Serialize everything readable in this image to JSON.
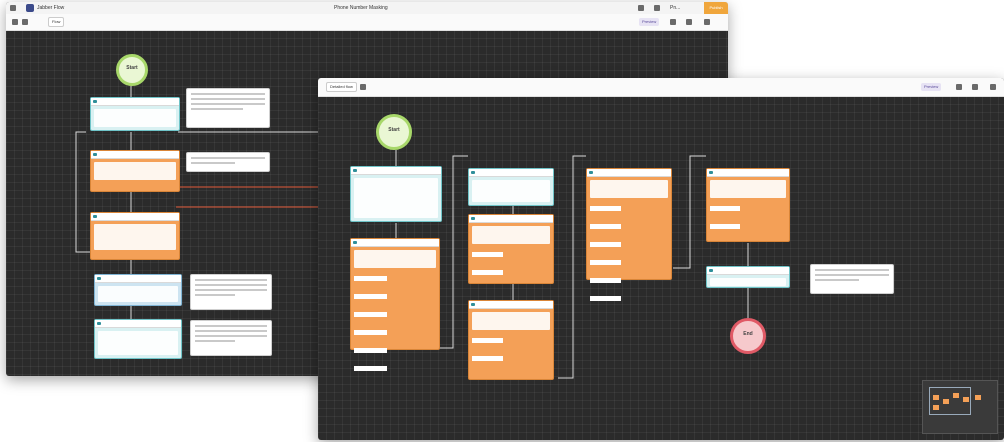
{
  "window1": {
    "title": "Phone Number Masking",
    "brand": "Jabber Flow",
    "version": "Pn...",
    "user": "",
    "tab": "Flow",
    "preview_label": "Preview",
    "publish_label": "Publish"
  },
  "window2": {
    "tab": "Detailed flow",
    "preview_label": "Preview"
  },
  "nodes": {
    "start_label": "Start",
    "end_label": "End"
  },
  "colors": {
    "canvas": "#2b2b2b",
    "teal_node": "#d9f1f2",
    "orange_node": "#f4a057",
    "accent": "#f0a63c",
    "start": "#a8d86a",
    "end": "#e05a66"
  }
}
